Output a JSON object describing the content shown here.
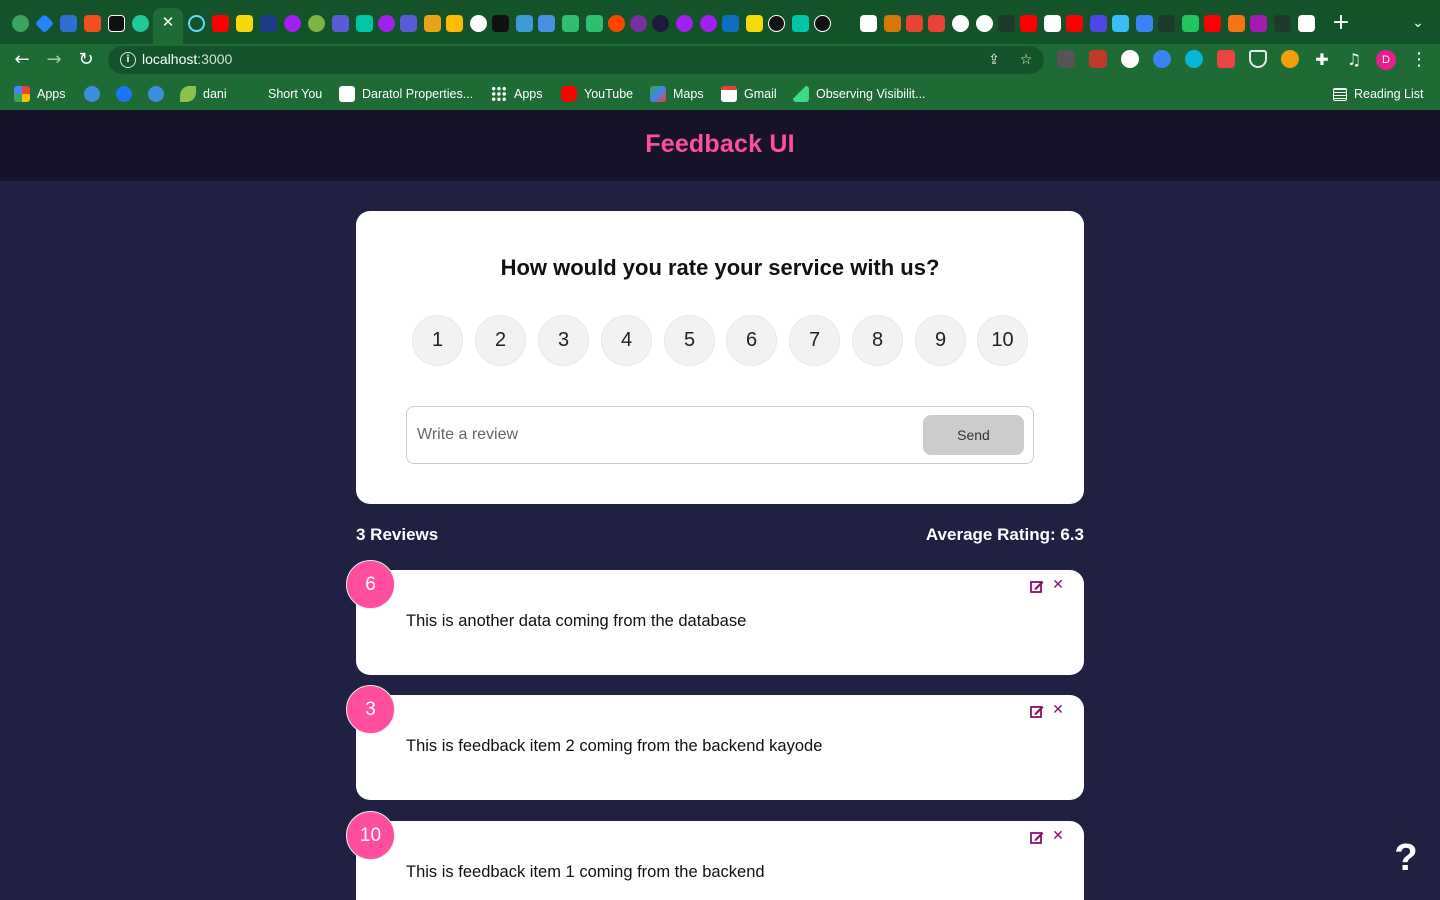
{
  "browser": {
    "url_host": "localhost",
    "url_port": ":3000",
    "tab_close_glyph": "✕",
    "new_tab_glyph": "+",
    "profile_initial": "D",
    "bookmarks": [
      {
        "label": "Apps",
        "icon": "apps-grid-icon",
        "color": "#e94235"
      },
      {
        "label": "",
        "icon": "wordpress-icon",
        "color": "#3c8fe0"
      },
      {
        "label": "",
        "icon": "facebook-icon",
        "color": "#1877f2"
      },
      {
        "label": "",
        "icon": "wordpress-icon",
        "color": "#3c8fe0"
      },
      {
        "label": "dani",
        "icon": "leaf-icon",
        "color": "#8bc34a"
      },
      {
        "label": "Short You",
        "icon": "",
        "color": ""
      },
      {
        "label": "Daratol Properties...",
        "icon": "house-icon",
        "color": "#ffffff"
      },
      {
        "label": "Apps",
        "icon": "apps-grid-icon",
        "color": "#ffffff"
      },
      {
        "label": "YouTube",
        "icon": "youtube-icon",
        "color": "#ff0000"
      },
      {
        "label": "Maps",
        "icon": "maps-icon",
        "color": "#34a853"
      },
      {
        "label": "Gmail",
        "icon": "gmail-icon",
        "color": "#ea4335"
      },
      {
        "label": "Observing Visibilit...",
        "icon": "stairs-icon",
        "color": "#3ddc84"
      }
    ],
    "reading_list": "Reading List"
  },
  "app": {
    "title": "Feedback UI",
    "rating_question": "How would you rate your service with us?",
    "ratings": [
      "1",
      "2",
      "3",
      "4",
      "5",
      "6",
      "7",
      "8",
      "9",
      "10"
    ],
    "review_placeholder": "Write a review",
    "send_label": "Send",
    "review_count_label": "3 Reviews",
    "average_label": "Average Rating: 6.3",
    "feedback": [
      {
        "rating": "6",
        "text": "This is another data coming from the database"
      },
      {
        "rating": "3",
        "text": "This is feedback item 2 coming from the backend kayode"
      },
      {
        "rating": "10",
        "text": "This is feedback item 1 coming from the backend"
      }
    ],
    "help_label": "?",
    "colors": {
      "accent": "#ff4f9c",
      "background": "#202142",
      "header": "#161328",
      "icon": "#8a0f6b"
    }
  }
}
